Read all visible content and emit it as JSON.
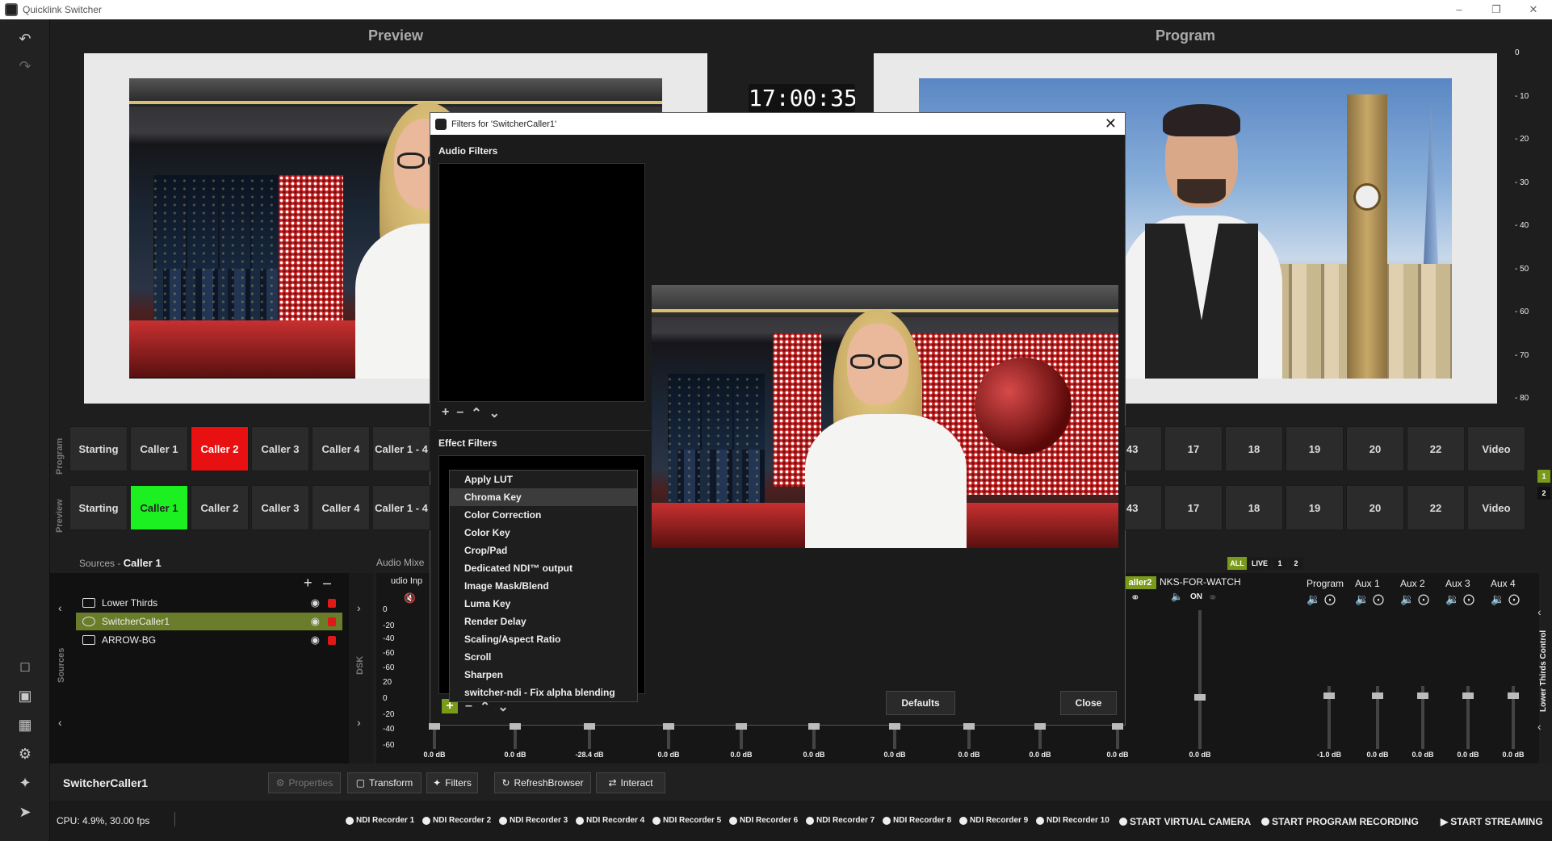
{
  "window": {
    "title": "Quicklink Switcher"
  },
  "panels": {
    "preview_title": "Preview",
    "program_title": "Program",
    "clock_text": "17:00:35"
  },
  "meter_ticks": [
    "0",
    "- 10",
    "- 20",
    "- 30",
    "- 40",
    "- 50",
    "- 60",
    "- 70",
    "- 80"
  ],
  "program_row_label": "Program",
  "preview_row_label": "Preview",
  "program_buttons": [
    "Starting",
    "Caller 1",
    "Caller 2",
    "Caller 3",
    "Caller 4",
    "Caller 1 - 4"
  ],
  "preview_buttons": [
    "Starting",
    "Caller 1",
    "Caller 2",
    "Caller 3",
    "Caller 4",
    "Caller 1 - 4"
  ],
  "program_buttons_right": [
    "43",
    "17",
    "18",
    "19",
    "20",
    "22",
    "Video"
  ],
  "preview_buttons_right": [
    "43",
    "17",
    "18",
    "19",
    "20",
    "22",
    "Video"
  ],
  "page_badges": [
    "1",
    "2"
  ],
  "colors": {
    "program_active": "#e81010",
    "preview_active": "#1df020",
    "selected_source": "#6a7d2a"
  },
  "sources": {
    "header_label": "Sources",
    "header_scene": "Caller 1",
    "side_label": "Sources",
    "dsk_label": "DSK",
    "items": [
      {
        "name": "Lower Thirds",
        "icon": "lower-thirds-icon"
      },
      {
        "name": "SwitcherCaller1",
        "icon": "browser-source-icon",
        "selected": true
      },
      {
        "name": "ARROW-BG",
        "icon": "image-source-icon"
      }
    ]
  },
  "audio_mixer": {
    "label": "Audio Mixe",
    "input_label": "udio Inp",
    "scale": [
      "0",
      "-20",
      "-40",
      "-60",
      "-60",
      "20",
      "0",
      "-20",
      "-40",
      "-60"
    ],
    "db_values": [
      "0.0 dB",
      "0.0 dB",
      "-28.4 dB",
      "0.0 dB",
      "0.0 dB",
      "0.0 dB",
      "0.0 dB",
      "0.0 dB",
      "0.0 dB",
      "0.0 dB",
      "0.0 dB"
    ],
    "channel_tag": "aller2",
    "channel_name": "NKS-FOR-WATCH",
    "on_label": "ON",
    "filter_tags": [
      "ALL",
      "LIVE",
      "1",
      "2"
    ],
    "aux_labels": [
      "Program",
      "Aux 1",
      "Aux 2",
      "Aux 3",
      "Aux 4"
    ],
    "aux_db": [
      "-1.0 dB",
      "0.0 dB",
      "0.0 dB",
      "0.0 dB",
      "0.0 dB"
    ],
    "lower_thirds_control": "Lower Thirds Control"
  },
  "toolbar": {
    "selected_source": "SwitcherCaller1",
    "properties": "Properties",
    "transform": "Transform",
    "filters": "Filters",
    "refresh_browser": "RefreshBrowser",
    "interact": "Interact"
  },
  "status": {
    "cpu": "CPU: 4.9%, 30.00 fps",
    "recorders": [
      "NDI Recorder 1",
      "NDI Recorder 2",
      "NDI Recorder 3",
      "NDI Recorder 4",
      "NDI Recorder 5",
      "NDI Recorder 6",
      "NDI Recorder 7",
      "NDI Recorder 8",
      "NDI Recorder 9",
      "NDI Recorder 10"
    ],
    "virtual_camera": "START VIRTUAL CAMERA",
    "program_recording": "START PROGRAM RECORDING",
    "streaming": "START STREAMING"
  },
  "dialog": {
    "title": "Filters for 'SwitcherCaller1'",
    "audio_filters_label": "Audio Filters",
    "effect_filters_label": "Effect Filters",
    "defaults": "Defaults",
    "close": "Close",
    "menu_items": [
      "Apply LUT",
      "Chroma Key",
      "Color Correction",
      "Color Key",
      "Crop/Pad",
      "Dedicated NDI™ output",
      "Image Mask/Blend",
      "Luma Key",
      "Render Delay",
      "Scaling/Aspect Ratio",
      "Scroll",
      "Sharpen",
      "switcher-ndi - Fix alpha blending"
    ],
    "highlighted_item": "Chroma Key"
  }
}
